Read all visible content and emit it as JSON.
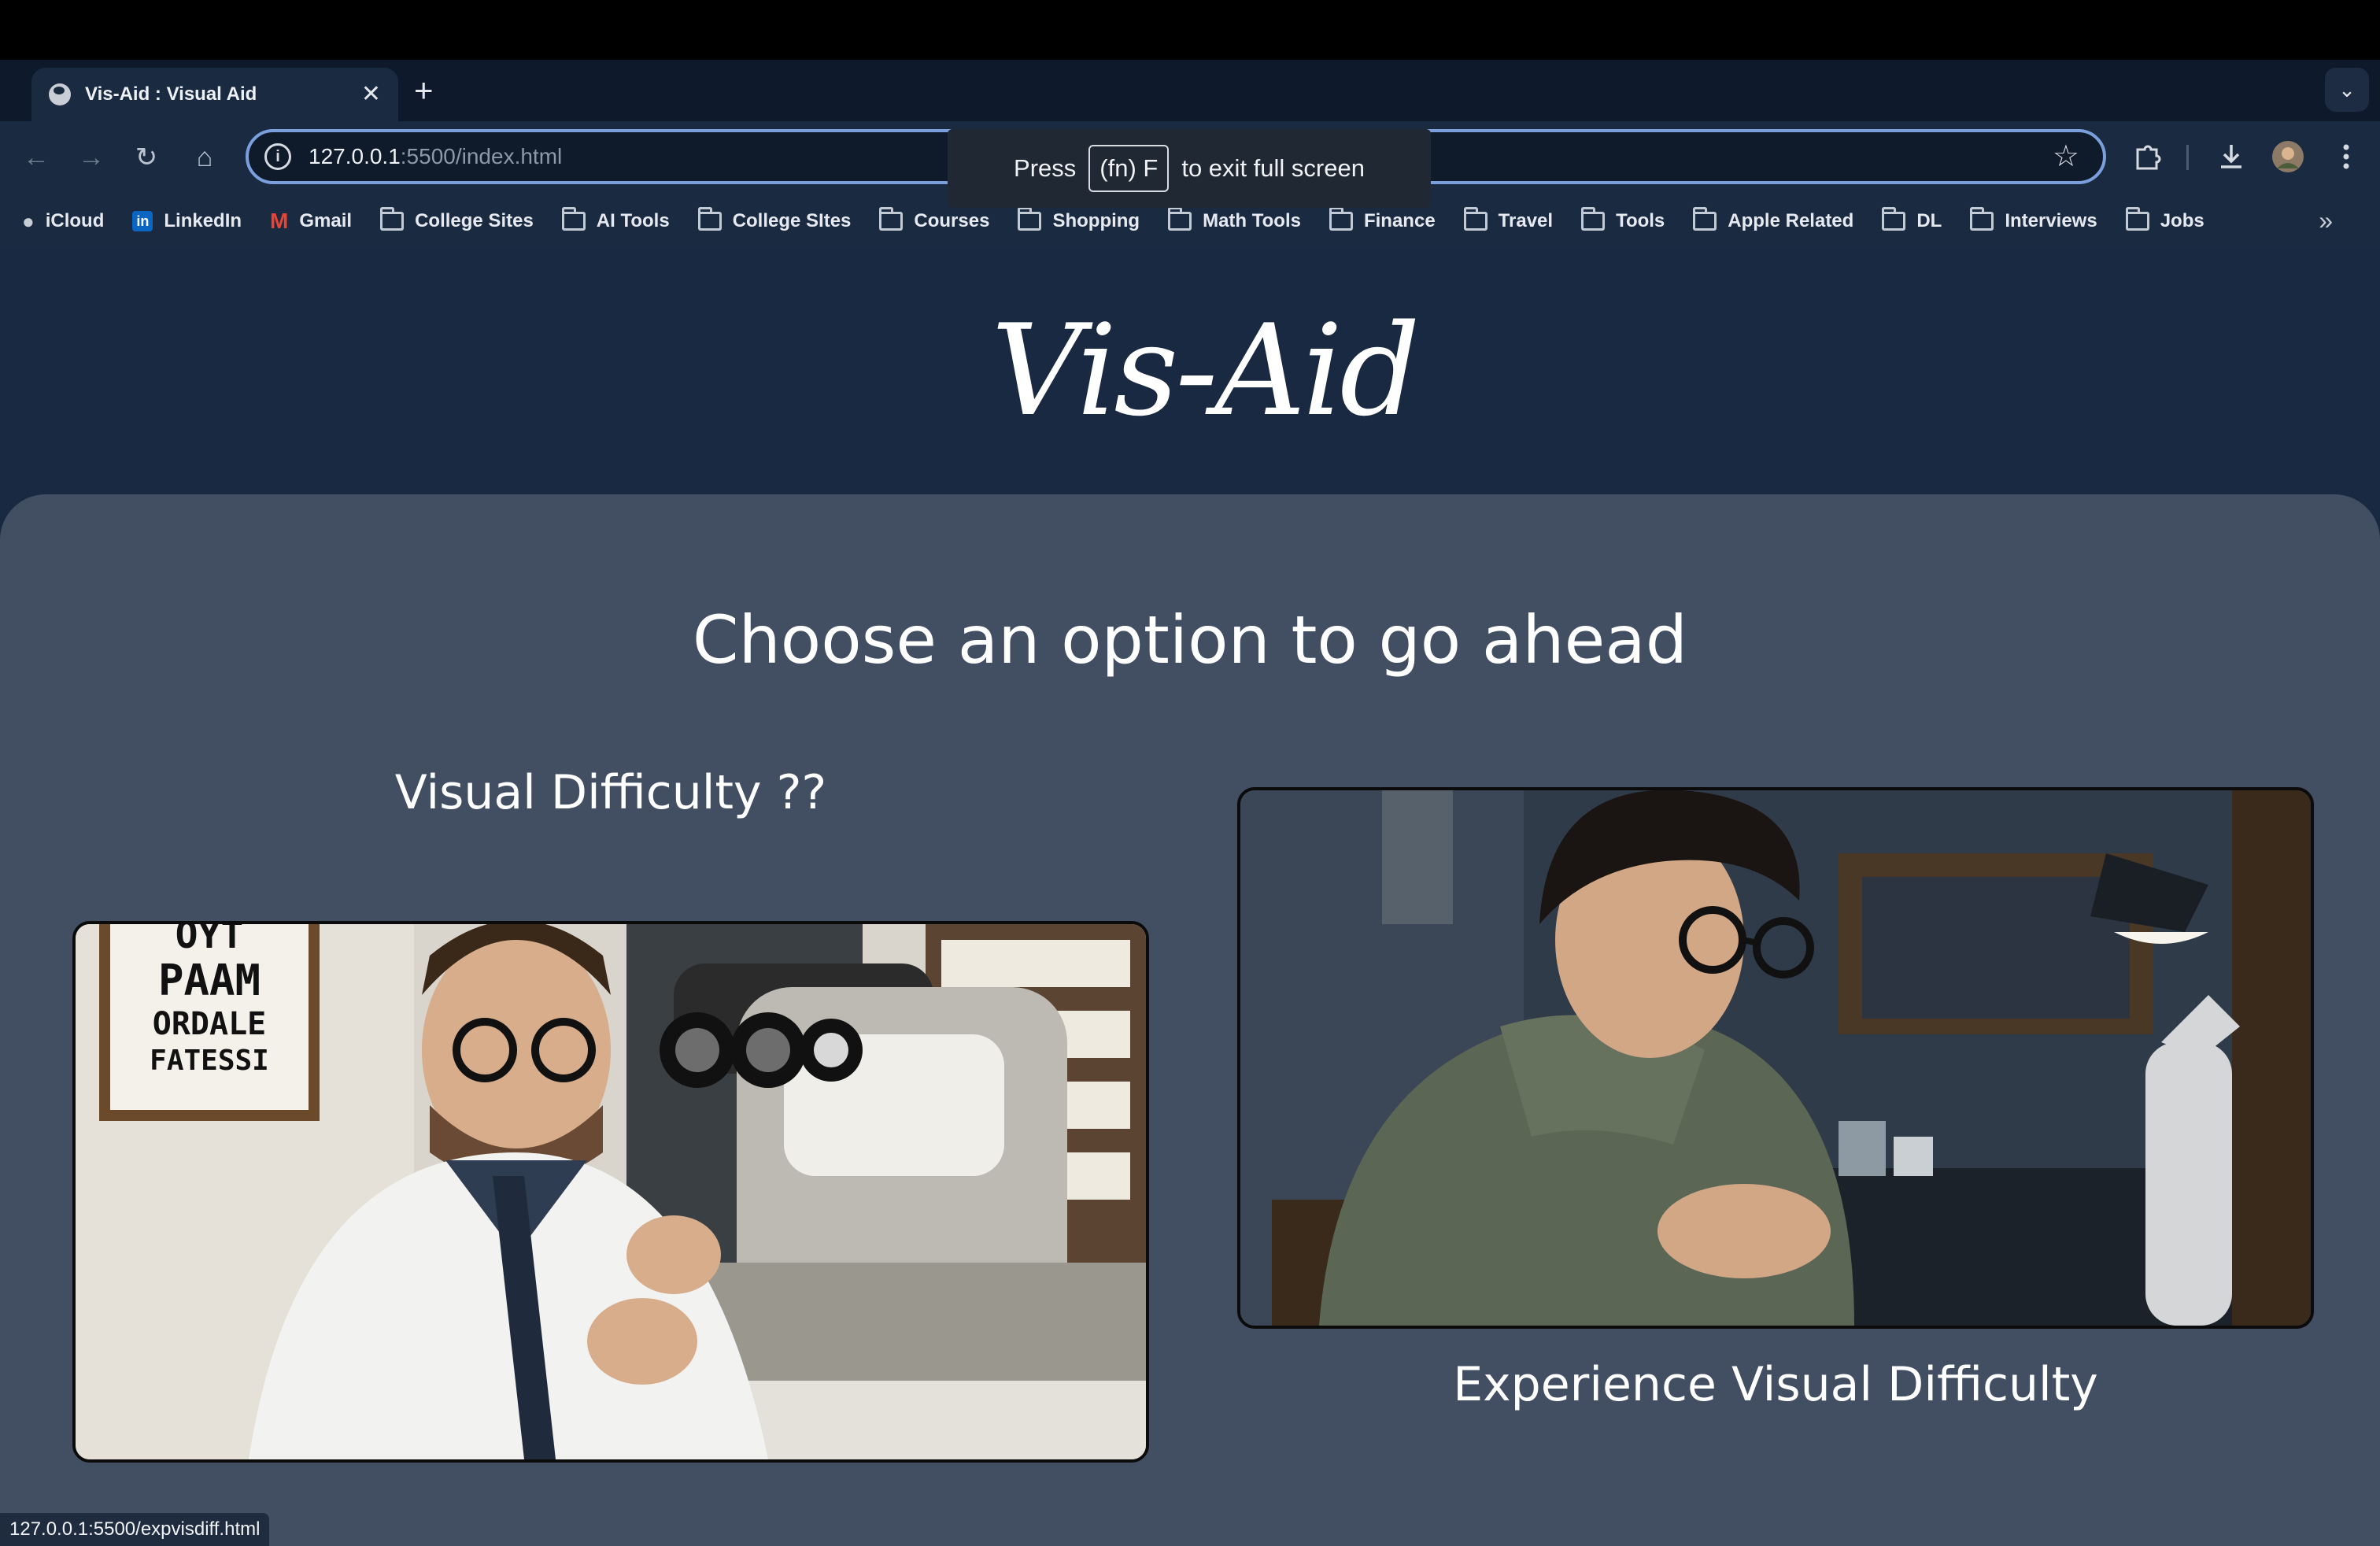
{
  "browser": {
    "tab_title": "Vis-Aid : Visual Aid",
    "tab_close": "✕",
    "new_tab": "+",
    "tab_search": "⌄",
    "nav": {
      "back": "←",
      "forward": "→",
      "reload": "↻",
      "home": "⌂"
    },
    "url_host": "127.0.0.1",
    "url_rest": ":5500/index.html",
    "fullscreen_notice": {
      "press": "Press",
      "key": "(fn) F",
      "rest": "to exit full screen"
    },
    "bookmarks": [
      {
        "label": "iCloud",
        "icon": "apple-icon"
      },
      {
        "label": "LinkedIn",
        "icon": "linkedin-icon"
      },
      {
        "label": "Gmail",
        "icon": "gmail-icon"
      },
      {
        "label": "College Sites",
        "icon": "folder-icon"
      },
      {
        "label": "AI Tools",
        "icon": "folder-icon"
      },
      {
        "label": "College SItes",
        "icon": "folder-icon"
      },
      {
        "label": "Courses",
        "icon": "folder-icon"
      },
      {
        "label": "Shopping",
        "icon": "folder-icon"
      },
      {
        "label": "Math Tools",
        "icon": "folder-icon"
      },
      {
        "label": "Finance",
        "icon": "folder-icon"
      },
      {
        "label": "Travel",
        "icon": "folder-icon"
      },
      {
        "label": "Tools",
        "icon": "folder-icon"
      },
      {
        "label": "Apple Related",
        "icon": "folder-icon"
      },
      {
        "label": "DL",
        "icon": "folder-icon"
      },
      {
        "label": "Interviews",
        "icon": "folder-icon"
      },
      {
        "label": "Jobs",
        "icon": "folder-icon"
      }
    ],
    "bookmarks_overflow": "»",
    "status_url": "127.0.0.1:5500/expvisdiff.html"
  },
  "page": {
    "logo_text": "Vis-Aid",
    "heading": "Choose an option to go ahead",
    "option_left_label": "Visual Difficulty ??",
    "option_right_label": "Experience Visual Difficulty",
    "eye_chart_lines": [
      "OYT",
      "PAAM",
      "ORDALE",
      "FATESSI"
    ]
  },
  "colors": {
    "page_bg": "#182941",
    "panel_bg": "#424e62",
    "accent_outline": "#7a9fdc"
  }
}
